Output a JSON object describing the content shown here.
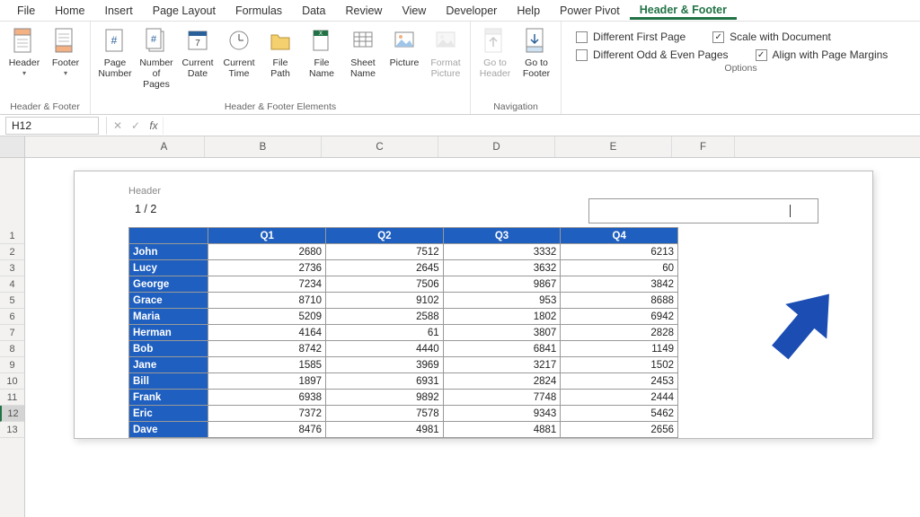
{
  "menu": {
    "items": [
      "File",
      "Home",
      "Insert",
      "Page Layout",
      "Formulas",
      "Data",
      "Review",
      "View",
      "Developer",
      "Help",
      "Power Pivot",
      "Header & Footer"
    ],
    "active_index": 11
  },
  "ribbon": {
    "group_hf": {
      "label": "Header & Footer",
      "header": "Header",
      "footer": "Footer"
    },
    "group_elems": {
      "label": "Header & Footer Elements",
      "items": [
        "Page Number",
        "Number of Pages",
        "Current Date",
        "Current Time",
        "File Path",
        "File Name",
        "Sheet Name",
        "Picture",
        "Format Picture"
      ]
    },
    "group_nav": {
      "label": "Navigation",
      "goheader": "Go to Header",
      "gofooter": "Go to Footer"
    },
    "group_opts": {
      "label": "Options",
      "dfp": "Different First Page",
      "doe": "Different Odd & Even Pages",
      "swd": "Scale with Document",
      "apm": "Align with Page Margins",
      "checked": {
        "dfp": false,
        "doe": false,
        "swd": true,
        "apm": true
      }
    }
  },
  "formula_bar": {
    "namebox": "H12",
    "fx": "fx"
  },
  "columns": [
    "A",
    "B",
    "C",
    "D",
    "E",
    "F"
  ],
  "rows": [
    1,
    2,
    3,
    4,
    5,
    6,
    7,
    8,
    9,
    10,
    11,
    12,
    13
  ],
  "selected_row": 12,
  "page_header": {
    "label": "Header",
    "left": "1 / 2"
  },
  "chart_data": {
    "type": "table",
    "headers": [
      "",
      "Q1",
      "Q2",
      "Q3",
      "Q4"
    ],
    "rows": [
      {
        "name": "John",
        "v": [
          2680,
          7512,
          3332,
          6213
        ]
      },
      {
        "name": "Lucy",
        "v": [
          2736,
          2645,
          3632,
          60
        ]
      },
      {
        "name": "George",
        "v": [
          7234,
          7506,
          9867,
          3842
        ]
      },
      {
        "name": "Grace",
        "v": [
          8710,
          9102,
          953,
          8688
        ]
      },
      {
        "name": "Maria",
        "v": [
          5209,
          2588,
          1802,
          6942
        ]
      },
      {
        "name": "Herman",
        "v": [
          4164,
          61,
          3807,
          2828
        ]
      },
      {
        "name": "Bob",
        "v": [
          8742,
          4440,
          6841,
          1149
        ]
      },
      {
        "name": "Jane",
        "v": [
          1585,
          3969,
          3217,
          1502
        ]
      },
      {
        "name": "Bill",
        "v": [
          1897,
          6931,
          2824,
          2453
        ]
      },
      {
        "name": "Frank",
        "v": [
          6938,
          9892,
          7748,
          2444
        ]
      },
      {
        "name": "Eric",
        "v": [
          7372,
          7578,
          9343,
          5462
        ]
      },
      {
        "name": "Dave",
        "v": [
          8476,
          4981,
          4881,
          2656
        ]
      }
    ]
  },
  "colors": {
    "accent": "#217346",
    "table_blue": "#1f5fbf",
    "arrow": "#1b4db3"
  }
}
